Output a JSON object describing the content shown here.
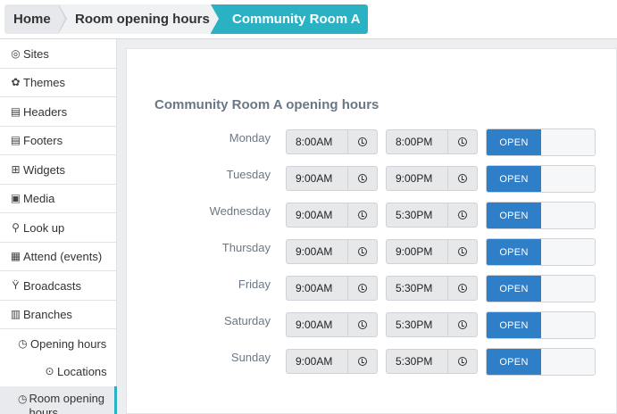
{
  "breadcrumb": {
    "home": "Home",
    "room_hours": "Room opening hours",
    "current": "Community Room A"
  },
  "sidebar": {
    "items": [
      {
        "label": "Sites",
        "icon": "globe-icon"
      },
      {
        "label": "Themes",
        "icon": "palette-icon"
      },
      {
        "label": "Headers",
        "icon": "header-icon"
      },
      {
        "label": "Footers",
        "icon": "footer-icon"
      },
      {
        "label": "Widgets",
        "icon": "widgets-icon"
      },
      {
        "label": "Media",
        "icon": "image-icon"
      },
      {
        "label": "Look up",
        "icon": "search-icon"
      },
      {
        "label": "Attend (events)",
        "icon": "calendar-icon"
      },
      {
        "label": "Broadcasts",
        "icon": "broadcast-icon"
      },
      {
        "label": "Branches",
        "icon": "building-icon"
      },
      {
        "label": "Opening hours",
        "icon": "clock-icon"
      },
      {
        "label": "Locations",
        "icon": "map-marker-icon"
      },
      {
        "label": "Room opening hours",
        "icon": "clock-icon"
      }
    ]
  },
  "main": {
    "title": "Community Room A opening hours",
    "toggle_label": "OPEN",
    "days": [
      {
        "day": "Monday",
        "open": "8:00AM",
        "close": "8:00PM",
        "status": "OPEN"
      },
      {
        "day": "Tuesday",
        "open": "9:00AM",
        "close": "9:00PM",
        "status": "OPEN"
      },
      {
        "day": "Wednesday",
        "open": "9:00AM",
        "close": "5:30PM",
        "status": "OPEN"
      },
      {
        "day": "Thursday",
        "open": "9:00AM",
        "close": "9:00PM",
        "status": "OPEN"
      },
      {
        "day": "Friday",
        "open": "9:00AM",
        "close": "5:30PM",
        "status": "OPEN"
      },
      {
        "day": "Saturday",
        "open": "9:00AM",
        "close": "5:30PM",
        "status": "OPEN"
      },
      {
        "day": "Sunday",
        "open": "9:00AM",
        "close": "5:30PM",
        "status": "OPEN"
      }
    ]
  },
  "colors": {
    "accent_teal": "#2ab2c4",
    "toggle_blue": "#2f7fc8",
    "title_gray": "#6b7785"
  }
}
